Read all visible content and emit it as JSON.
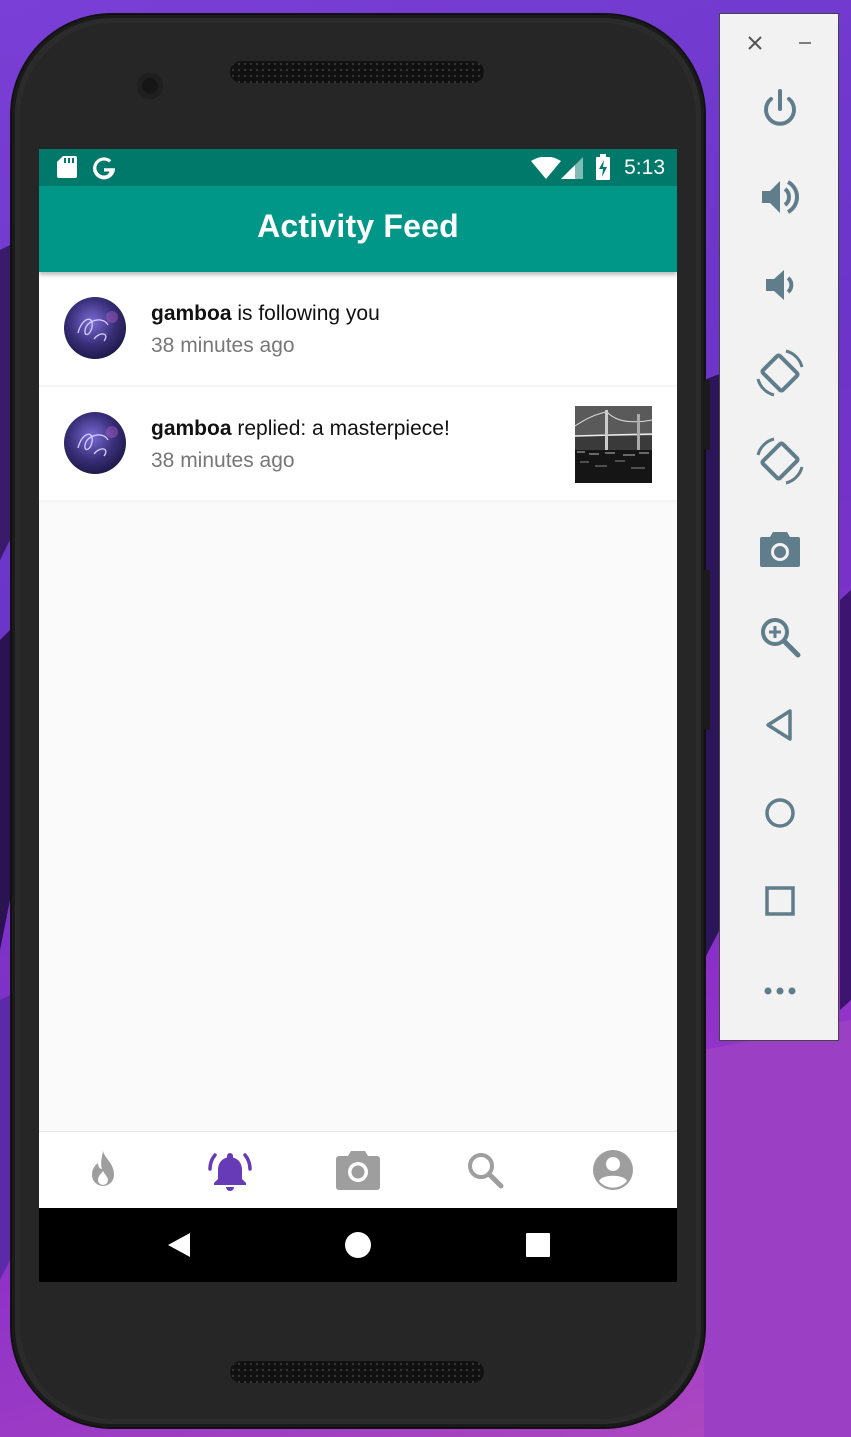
{
  "status_bar": {
    "time": "5:13",
    "icons": [
      "sd-card-icon",
      "google-icon",
      "wifi-icon",
      "signal-icon",
      "battery-icon"
    ]
  },
  "app_bar": {
    "title": "Activity Feed"
  },
  "feed": [
    {
      "username": "gamboa",
      "message": " is following you",
      "time": "38 minutes ago",
      "has_thumbnail": false
    },
    {
      "username": "gamboa",
      "message": " replied: a masterpiece!",
      "time": "38 minutes ago",
      "has_thumbnail": true
    }
  ],
  "bottom_nav": {
    "items": [
      "flame-icon",
      "notifications-icon",
      "camera-icon",
      "search-icon",
      "account-icon"
    ],
    "active": "notifications-icon",
    "active_color": "#673ab7",
    "inactive_color": "#9e9e9e"
  },
  "emulator_panel": {
    "controls": [
      "close-icon",
      "minimize-icon",
      "power-icon",
      "volume-up-icon",
      "volume-down-icon",
      "rotate-left-icon",
      "rotate-right-icon",
      "screenshot-icon",
      "zoom-icon",
      "back-icon",
      "home-icon",
      "overview-icon",
      "more-icon"
    ]
  },
  "colors": {
    "status_bar": "#00796b",
    "app_bar": "#009688",
    "panel_icon": "#607d8b"
  }
}
